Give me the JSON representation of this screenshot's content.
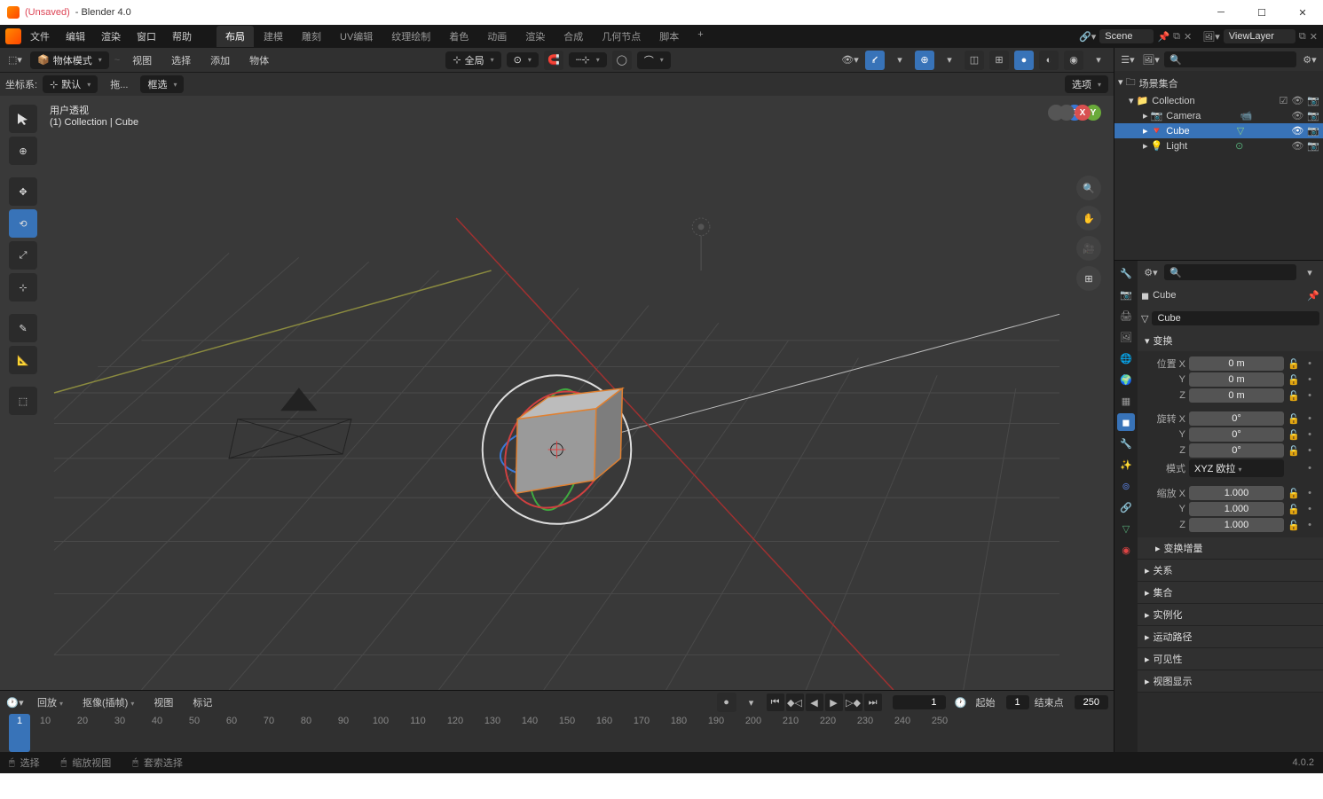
{
  "titlebar": {
    "unsaved": "(Unsaved)",
    "app": "- Blender 4.0"
  },
  "menus": {
    "file": "文件",
    "edit": "编辑",
    "render": "渲染",
    "window": "窗口",
    "help": "帮助"
  },
  "workspaces": {
    "layout": "布局",
    "modeling": "建模",
    "sculpt": "雕刻",
    "uv": "UV编辑",
    "texture": "纹理绘制",
    "shading": "着色",
    "anim": "动画",
    "render": "渲染",
    "compose": "合成",
    "geo": "几何节点",
    "script": "脚本"
  },
  "scene": {
    "label": "Scene",
    "viewlayer": "ViewLayer"
  },
  "viewHeader": {
    "mode": "物体模式",
    "view": "视图",
    "select": "选择",
    "add": "添加",
    "object": "物体",
    "global": "全局",
    "options": "选项"
  },
  "subheader": {
    "coord": "坐标系:",
    "default": "默认",
    "drag": "拖...",
    "boxselect": "框选"
  },
  "overlay": {
    "title": "用户透视",
    "coll": "(1) Collection | Cube"
  },
  "outliner": {
    "scene": "场景集合",
    "collection": "Collection",
    "camera": "Camera",
    "cube": "Cube",
    "light": "Light"
  },
  "props": {
    "obj": "Cube",
    "mesh": "Cube",
    "transform": "变换",
    "posX": "位置 X",
    "Y": "Y",
    "Z": "Z",
    "rotX": "旋转 X",
    "mode": "模式",
    "modeVal": "XYZ 欧拉",
    "scaleX": "缩放 X",
    "pos": {
      "x": "0 m",
      "y": "0 m",
      "z": "0 m"
    },
    "rot": {
      "x": "0°",
      "y": "0°",
      "z": "0°"
    },
    "scale": {
      "x": "1.000",
      "y": "1.000",
      "z": "1.000"
    },
    "delta": "变换增量",
    "rel": "关系",
    "coll": "集合",
    "inst": "实例化",
    "motion": "运动路径",
    "vis": "可见性",
    "viewdisp": "视图显示"
  },
  "timeline": {
    "playback": "回放",
    "keying": "抠像(插帧)",
    "view": "视图",
    "marker": "标记",
    "start": "起始",
    "startV": "1",
    "end": "结束点",
    "endV": "250",
    "current": "1",
    "frames": [
      "1",
      "10",
      "20",
      "30",
      "40",
      "50",
      "60",
      "70",
      "80",
      "90",
      "100",
      "110",
      "120",
      "130",
      "140",
      "150",
      "160",
      "170",
      "180",
      "190",
      "200",
      "210",
      "220",
      "230",
      "240",
      "250"
    ]
  },
  "status": {
    "select": "选择",
    "zoom": "缩放视图",
    "lasso": "套索选择",
    "version": "4.0.2"
  }
}
